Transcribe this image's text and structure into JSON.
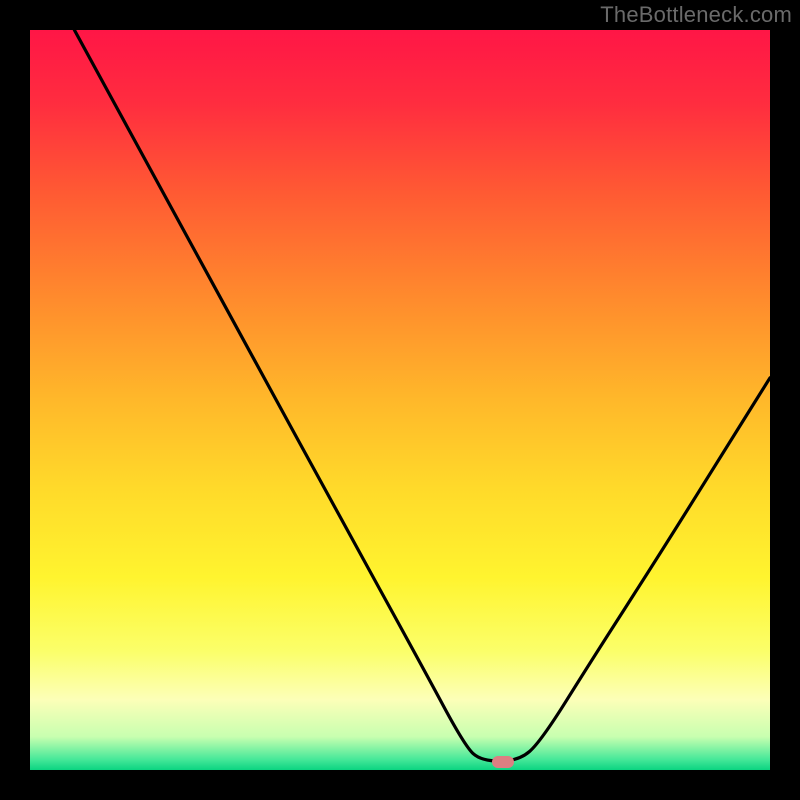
{
  "watermark": {
    "text": "TheBottleneck.com"
  },
  "frame": {
    "border_color": "#000000",
    "inner_left": 30,
    "inner_top": 30,
    "inner_size": 740
  },
  "gradient_stops": [
    {
      "offset": 0.0,
      "color": "#ff1646"
    },
    {
      "offset": 0.1,
      "color": "#ff2d3f"
    },
    {
      "offset": 0.22,
      "color": "#ff5a33"
    },
    {
      "offset": 0.36,
      "color": "#ff8a2d"
    },
    {
      "offset": 0.5,
      "color": "#ffb82a"
    },
    {
      "offset": 0.62,
      "color": "#ffda2a"
    },
    {
      "offset": 0.74,
      "color": "#fff42f"
    },
    {
      "offset": 0.84,
      "color": "#fbff6a"
    },
    {
      "offset": 0.905,
      "color": "#fcffb8"
    },
    {
      "offset": 0.955,
      "color": "#c8ffb0"
    },
    {
      "offset": 0.985,
      "color": "#49e99a"
    },
    {
      "offset": 1.0,
      "color": "#0bd481"
    }
  ],
  "marker": {
    "color": "#dc7f82",
    "x_frac": 0.639,
    "y_frac": 0.989
  },
  "chart_data": {
    "type": "line",
    "title": "",
    "xlabel": "",
    "ylabel": "",
    "ylim": [
      0,
      100
    ],
    "xlim": [
      0,
      100
    ],
    "series": [
      {
        "name": "bottleneck_curve",
        "points": [
          {
            "x": 6.0,
            "y": 100.0
          },
          {
            "x": 18.0,
            "y": 78.0
          },
          {
            "x": 30.0,
            "y": 56.0
          },
          {
            "x": 42.0,
            "y": 34.0
          },
          {
            "x": 53.0,
            "y": 14.0
          },
          {
            "x": 58.8,
            "y": 3.2
          },
          {
            "x": 61.0,
            "y": 1.2
          },
          {
            "x": 66.0,
            "y": 1.2
          },
          {
            "x": 69.0,
            "y": 3.8
          },
          {
            "x": 76.0,
            "y": 15.0
          },
          {
            "x": 85.0,
            "y": 29.0
          },
          {
            "x": 95.0,
            "y": 45.0
          },
          {
            "x": 100.0,
            "y": 53.0
          }
        ]
      }
    ],
    "optimal_marker_x": 63.9
  }
}
